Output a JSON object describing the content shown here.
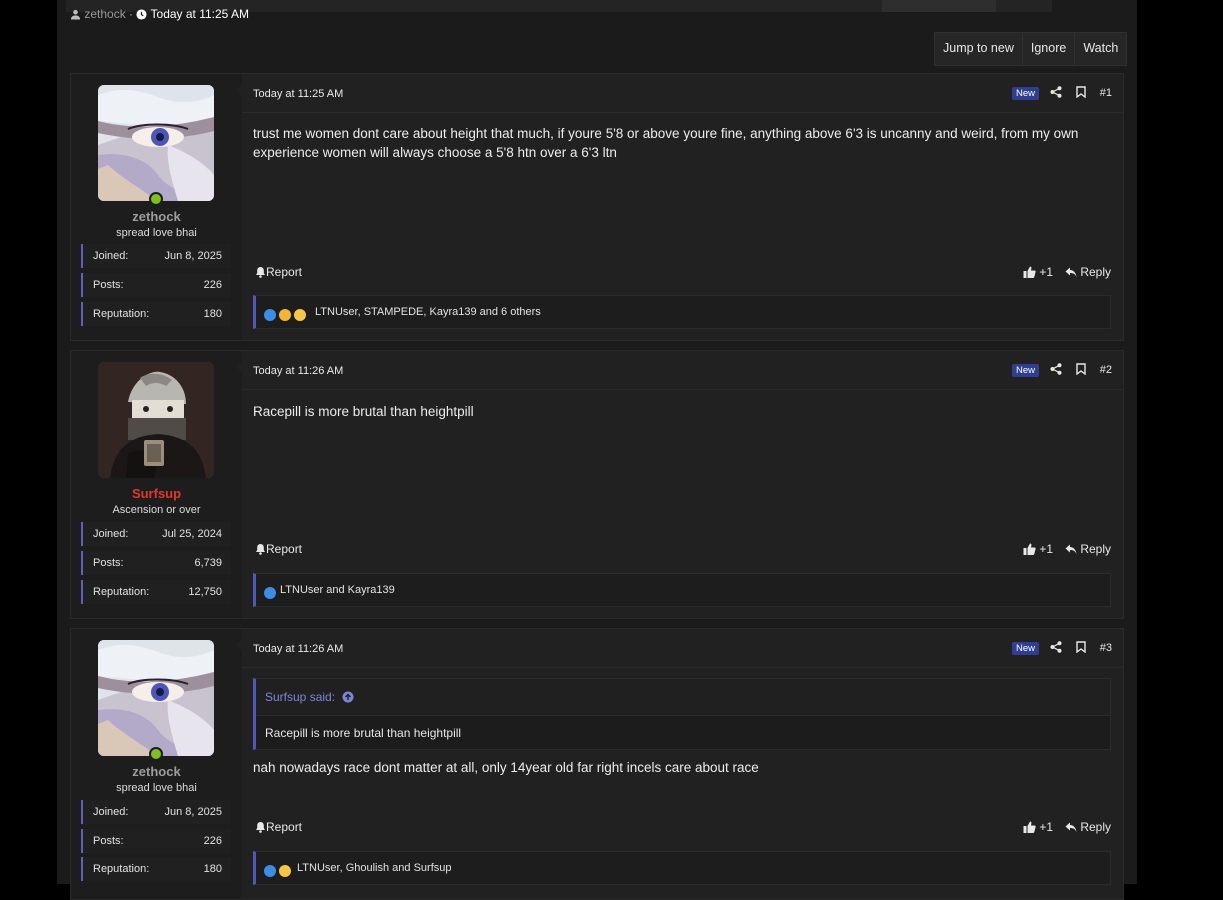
{
  "thread_meta": {
    "author": "zethock",
    "separator": "·",
    "time": "Today at 11:25 AM"
  },
  "actions": {
    "jump": "Jump to new",
    "ignore": "Ignore",
    "watch": "Watch"
  },
  "posts": [
    {
      "user": {
        "name": "zethock",
        "title": "spread love bhai",
        "joined_label": "Joined:",
        "joined": "Jun 8, 2025",
        "posts_label": "Posts:",
        "posts": "226",
        "rep_label": "Reputation:",
        "rep": "180"
      },
      "date": "Today at 11:25 AM",
      "new_tag": "New",
      "number": "#1",
      "text": "trust me women dont care about height that much, if youre 5'8 or above youre fine, anything above 6'3 is uncanny and weird, from my own experience women will always choose a 5'8 htn over a 6'3 ltn",
      "report": "Report",
      "like": "+1",
      "reply": "Reply",
      "reactions": "LTNUser, STAMPEDE, Kayra139 and 6 others"
    },
    {
      "user": {
        "name": "Surfsup",
        "title": "Ascension or over",
        "joined_label": "Joined:",
        "joined": "Jul 25, 2024",
        "posts_label": "Posts:",
        "posts": "6,739",
        "rep_label": "Reputation:",
        "rep": "12,750"
      },
      "date": "Today at 11:26 AM",
      "new_tag": "New",
      "number": "#2",
      "text": "Racepill is more brutal than heightpill",
      "report": "Report",
      "like": "+1",
      "reply": "Reply",
      "reactions": "LTNUser and Kayra139"
    },
    {
      "user": {
        "name": "zethock",
        "title": "spread love bhai",
        "joined_label": "Joined:",
        "joined": "Jun 8, 2025",
        "posts_label": "Posts:",
        "posts": "226",
        "rep_label": "Reputation:",
        "rep": "180"
      },
      "date": "Today at 11:26 AM",
      "new_tag": "New",
      "number": "#3",
      "quote_author": "Surfsup said:",
      "quote_text": "Racepill is more brutal than heightpill",
      "text": "nah nowadays race dont matter at all, only 14year old far right incels care about race",
      "report": "Report",
      "like": "+1",
      "reply": "Reply",
      "reactions": "LTNUser, Ghoulish and Surfsup"
    }
  ],
  "colors": {
    "accent": "#4e58b8",
    "new_badge": "#2f3e91",
    "online": "#7dc11f",
    "staff_red": "#e0392b"
  }
}
